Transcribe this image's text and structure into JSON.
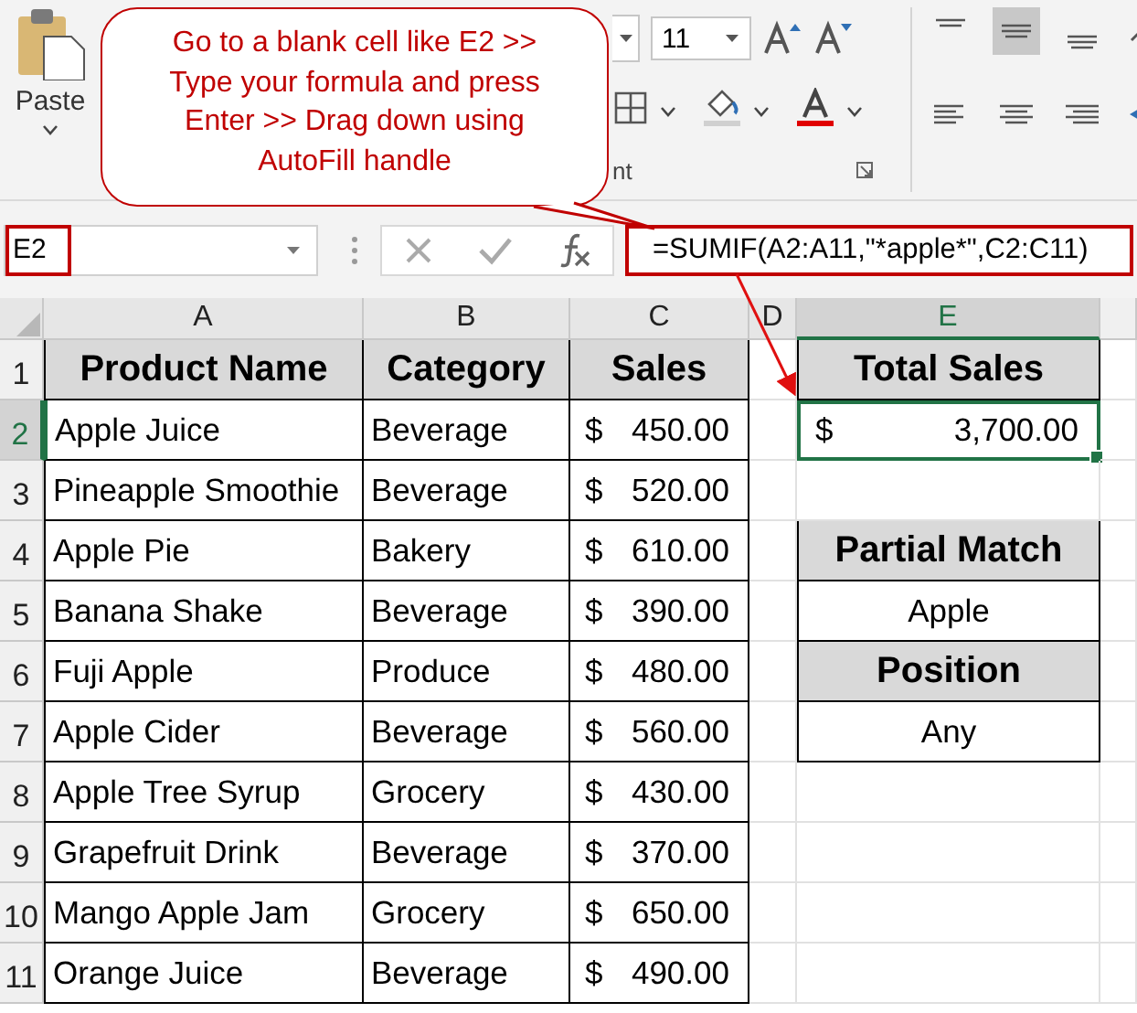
{
  "ribbon": {
    "paste_label": "Paste",
    "font_size": "11",
    "group_label": "nt"
  },
  "callout": {
    "text": "Go to a blank cell like E2 >> Type your formula and press Enter >> Drag down using AutoFill handle"
  },
  "formula_bar": {
    "name_box": "E2",
    "formula": "=SUMIF(A2:A11,\"*apple*\",C2:C11)"
  },
  "columns": [
    {
      "label": "A",
      "selected": false
    },
    {
      "label": "B",
      "selected": false
    },
    {
      "label": "C",
      "selected": false
    },
    {
      "label": "D",
      "selected": false
    },
    {
      "label": "E",
      "selected": true
    }
  ],
  "rows": [
    {
      "label": "1",
      "selected": false
    },
    {
      "label": "2",
      "selected": true
    },
    {
      "label": "3",
      "selected": false
    },
    {
      "label": "4",
      "selected": false
    },
    {
      "label": "5",
      "selected": false
    },
    {
      "label": "6",
      "selected": false
    },
    {
      "label": "7",
      "selected": false
    },
    {
      "label": "8",
      "selected": false
    },
    {
      "label": "9",
      "selected": false
    },
    {
      "label": "10",
      "selected": false
    },
    {
      "label": "11",
      "selected": false
    }
  ],
  "table": {
    "headers": [
      "Product Name",
      "Category",
      "Sales"
    ],
    "rows": [
      {
        "product": "Apple Juice",
        "category": "Beverage",
        "currency": "$",
        "amount": "450.00"
      },
      {
        "product": "Pineapple Smoothie",
        "category": "Beverage",
        "currency": "$",
        "amount": "520.00"
      },
      {
        "product": "Apple Pie",
        "category": "Bakery",
        "currency": "$",
        "amount": "610.00"
      },
      {
        "product": "Banana Shake",
        "category": "Beverage",
        "currency": "$",
        "amount": "390.00"
      },
      {
        "product": "Fuji Apple",
        "category": "Produce",
        "currency": "$",
        "amount": "480.00"
      },
      {
        "product": "Apple Cider",
        "category": "Beverage",
        "currency": "$",
        "amount": "560.00"
      },
      {
        "product": "Apple Tree Syrup",
        "category": "Grocery",
        "currency": "$",
        "amount": "430.00"
      },
      {
        "product": "Grapefruit Drink",
        "category": "Beverage",
        "currency": "$",
        "amount": "370.00"
      },
      {
        "product": "Mango Apple Jam",
        "category": "Grocery",
        "currency": "$",
        "amount": "650.00"
      },
      {
        "product": "Orange Juice",
        "category": "Beverage",
        "currency": "$",
        "amount": "490.00"
      }
    ]
  },
  "side_cells": [
    {
      "kind": "header",
      "text": "Total Sales",
      "selected": false
    },
    {
      "kind": "currency",
      "currency": "$",
      "amount": "3,700.00",
      "selected": true
    },
    {
      "kind": "blank",
      "selected": false
    },
    {
      "kind": "header",
      "text": "Partial Match",
      "selected": false
    },
    {
      "kind": "value",
      "text": "Apple",
      "selected": false
    },
    {
      "kind": "header",
      "text": "Position",
      "selected": false
    },
    {
      "kind": "value",
      "text": "Any",
      "selected": false
    }
  ]
}
